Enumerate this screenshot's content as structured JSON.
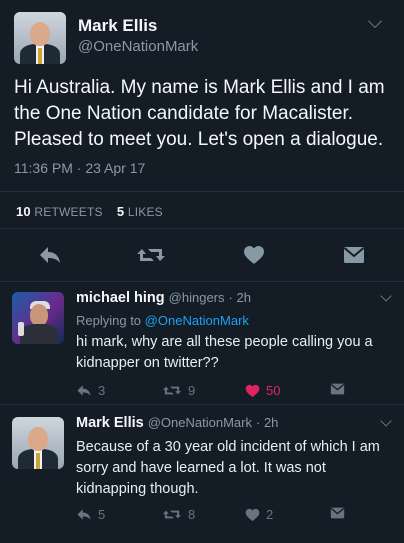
{
  "main_tweet": {
    "display_name": "Mark Ellis",
    "handle": "@OneNationMark",
    "text": "Hi Australia. My name is Mark Ellis and I am the One Nation candidate for Macalister. Pleased to meet you. Let's open a dialogue.",
    "timestamp": "11:36 PM · 23 Apr 17",
    "retweets_count": "10",
    "retweets_label": "RETWEETS",
    "likes_count": "5",
    "likes_label": "LIKES"
  },
  "replies": [
    {
      "display_name": "michael hing",
      "handle": "@hingers",
      "time": "· 2h",
      "replying_to_label": "Replying to",
      "replying_to_handle": "@OneNationMark",
      "text": "hi mark, why are all these people calling you a kidnapper on twitter??",
      "reply_count": "3",
      "retweet_count": "9",
      "like_count": "50",
      "liked": true
    },
    {
      "display_name": "Mark Ellis",
      "handle": "@OneNationMark",
      "time": "· 2h",
      "text": "Because of a 30 year old incident of which I am sorry and have learned a lot. It was not kidnapping though.",
      "reply_count": "5",
      "retweet_count": "8",
      "like_count": "2",
      "liked": false
    }
  ],
  "colors": {
    "background": "#141d26",
    "link": "#1da1f2",
    "muted": "#8899a6",
    "like_active": "#e0245e"
  },
  "icons": [
    "reply-icon",
    "retweet-icon",
    "like-icon",
    "direct-message-icon",
    "chevron-down-icon"
  ]
}
